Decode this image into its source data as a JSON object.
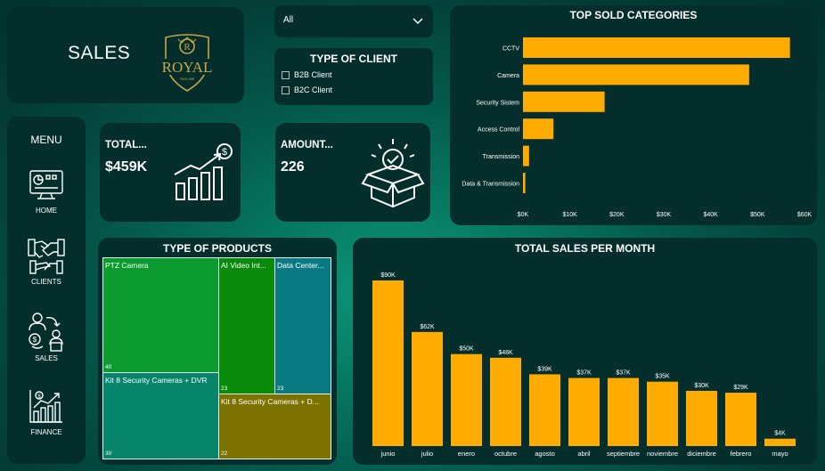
{
  "header": {
    "title": "SALES",
    "logo_text": "ROYAL",
    "logo_sub": "TAGLINE",
    "logo_letter": "R"
  },
  "filter": {
    "selected": "All"
  },
  "client_filter": {
    "title": "TYPE OF CLIENT",
    "options": [
      "B2B Client",
      "B2C Client"
    ]
  },
  "menu": {
    "title": "MENU",
    "items": [
      {
        "label": "HOME",
        "icon": "dashboard-icon"
      },
      {
        "label": "CLIENTS",
        "icon": "handshake-icon"
      },
      {
        "label": "SALES",
        "icon": "sales-exchange-icon"
      },
      {
        "label": "FINANCE",
        "icon": "finance-chart-icon"
      }
    ]
  },
  "kpis": {
    "total": {
      "label": "TOTAL...",
      "value": "$459K",
      "icon": "growth-chart-icon"
    },
    "amount": {
      "label": "AMOUNT...",
      "value": "226",
      "icon": "open-box-check-icon"
    }
  },
  "colors": {
    "bar": "#ffab00",
    "card": "#032e2c",
    "treemap": [
      "#0b9b2f",
      "#0a8a0a",
      "#0a7a82",
      "#06856a",
      "#7d7200"
    ]
  },
  "products": {
    "title": "TYPE OF PRODUCTS",
    "cells": [
      {
        "label": "PTZ Camera",
        "count": "40"
      },
      {
        "label": "AI Video Int...",
        "count": "23"
      },
      {
        "label": "Data Center...",
        "count": "23"
      },
      {
        "label": "Kit 8 Security Cameras + DVR",
        "count": "30"
      },
      {
        "label": "Kit 8 Security Cameras + D...",
        "count": "22"
      }
    ]
  },
  "chart_data": [
    {
      "type": "bar",
      "orientation": "horizontal",
      "title": "TOP SOLD CATEGORIES",
      "categories": [
        "CCTV",
        "Camera",
        "Security Sistem",
        "Access Control",
        "Transmission",
        "Data & Transmission"
      ],
      "values": [
        56900,
        48200,
        17400,
        6500,
        1300,
        500
      ],
      "xticks": [
        "$0K",
        "$10K",
        "$20K",
        "$30K",
        "$40K",
        "$50K",
        "$60K"
      ],
      "xlim": [
        0,
        60000
      ],
      "grid": false
    },
    {
      "type": "bar",
      "title": "TOTAL SALES PER MONTH",
      "categories": [
        "junio",
        "julio",
        "enero",
        "octubre",
        "agosto",
        "abril",
        "septiembre",
        "noviembre",
        "diciembre",
        "febrero",
        "mayo"
      ],
      "values": [
        90,
        62,
        50,
        48,
        39,
        37,
        37,
        35,
        30,
        29,
        4
      ],
      "data_labels": [
        "$90K",
        "$62K",
        "$50K",
        "$48K",
        "$39K",
        "$37K",
        "$37K",
        "$35K",
        "$30K",
        "$29K",
        "$4K"
      ],
      "ylim": [
        0,
        90
      ],
      "grid": false
    }
  ]
}
